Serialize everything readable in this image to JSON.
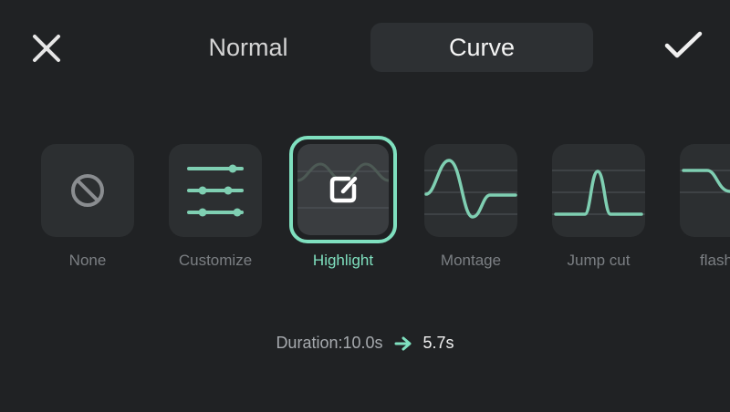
{
  "header": {
    "tabs": [
      {
        "label": "Normal",
        "active": false
      },
      {
        "label": "Curve",
        "active": true
      }
    ]
  },
  "presets": [
    {
      "label": "None",
      "icon": "prohibit-icon"
    },
    {
      "label": "Customize",
      "icon": "sliders-icon"
    },
    {
      "label": "Highlight",
      "icon": "edit-square-icon",
      "selected": true
    },
    {
      "label": "Montage",
      "icon": "montage-curve-icon"
    },
    {
      "label": "Jump cut",
      "icon": "jump-cut-curve-icon"
    },
    {
      "label": "flash",
      "icon": "flash-curve-icon"
    }
  ],
  "duration": {
    "original": "Duration:10.0s",
    "new": "5.7s"
  },
  "colors": {
    "accent": "#7fe0bf",
    "background": "#202224",
    "tile": "#2c2f31"
  }
}
